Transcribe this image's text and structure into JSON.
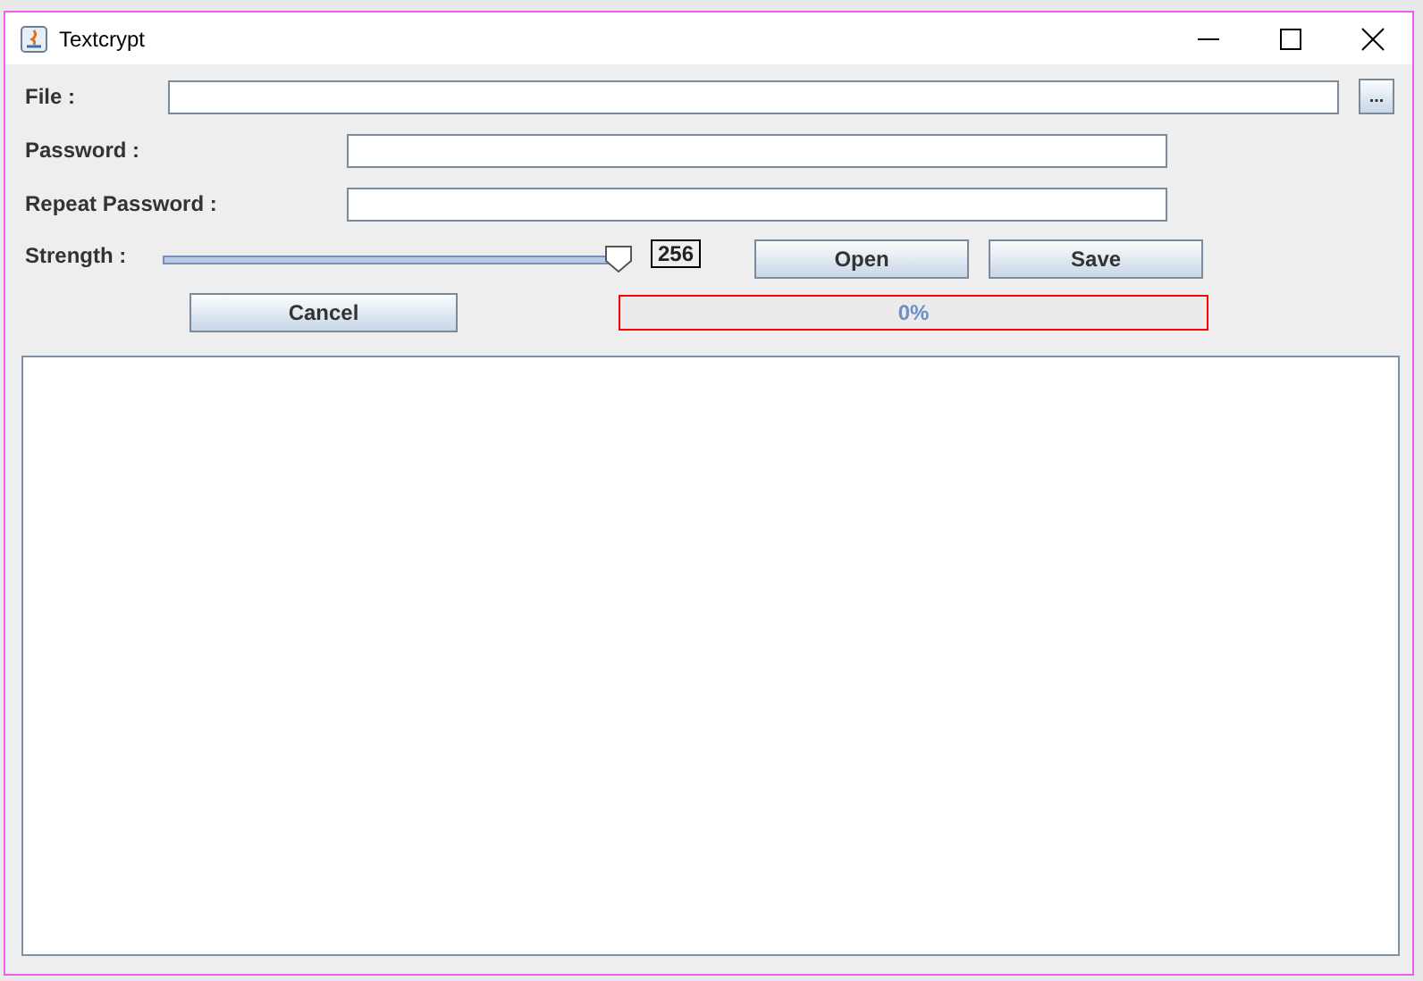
{
  "window": {
    "title": "Textcrypt"
  },
  "form": {
    "file_label": "File :",
    "file_button": "...",
    "password_label": "Password :",
    "repeat_label": "Repeat Password :",
    "strength_label": "Strength :"
  },
  "strength": {
    "level": 0.98,
    "reading": "256"
  },
  "buttons": {
    "open": "Open",
    "save": "Save",
    "cancel": "Cancel"
  },
  "progress": {
    "level": 0,
    "reading": "0%"
  }
}
